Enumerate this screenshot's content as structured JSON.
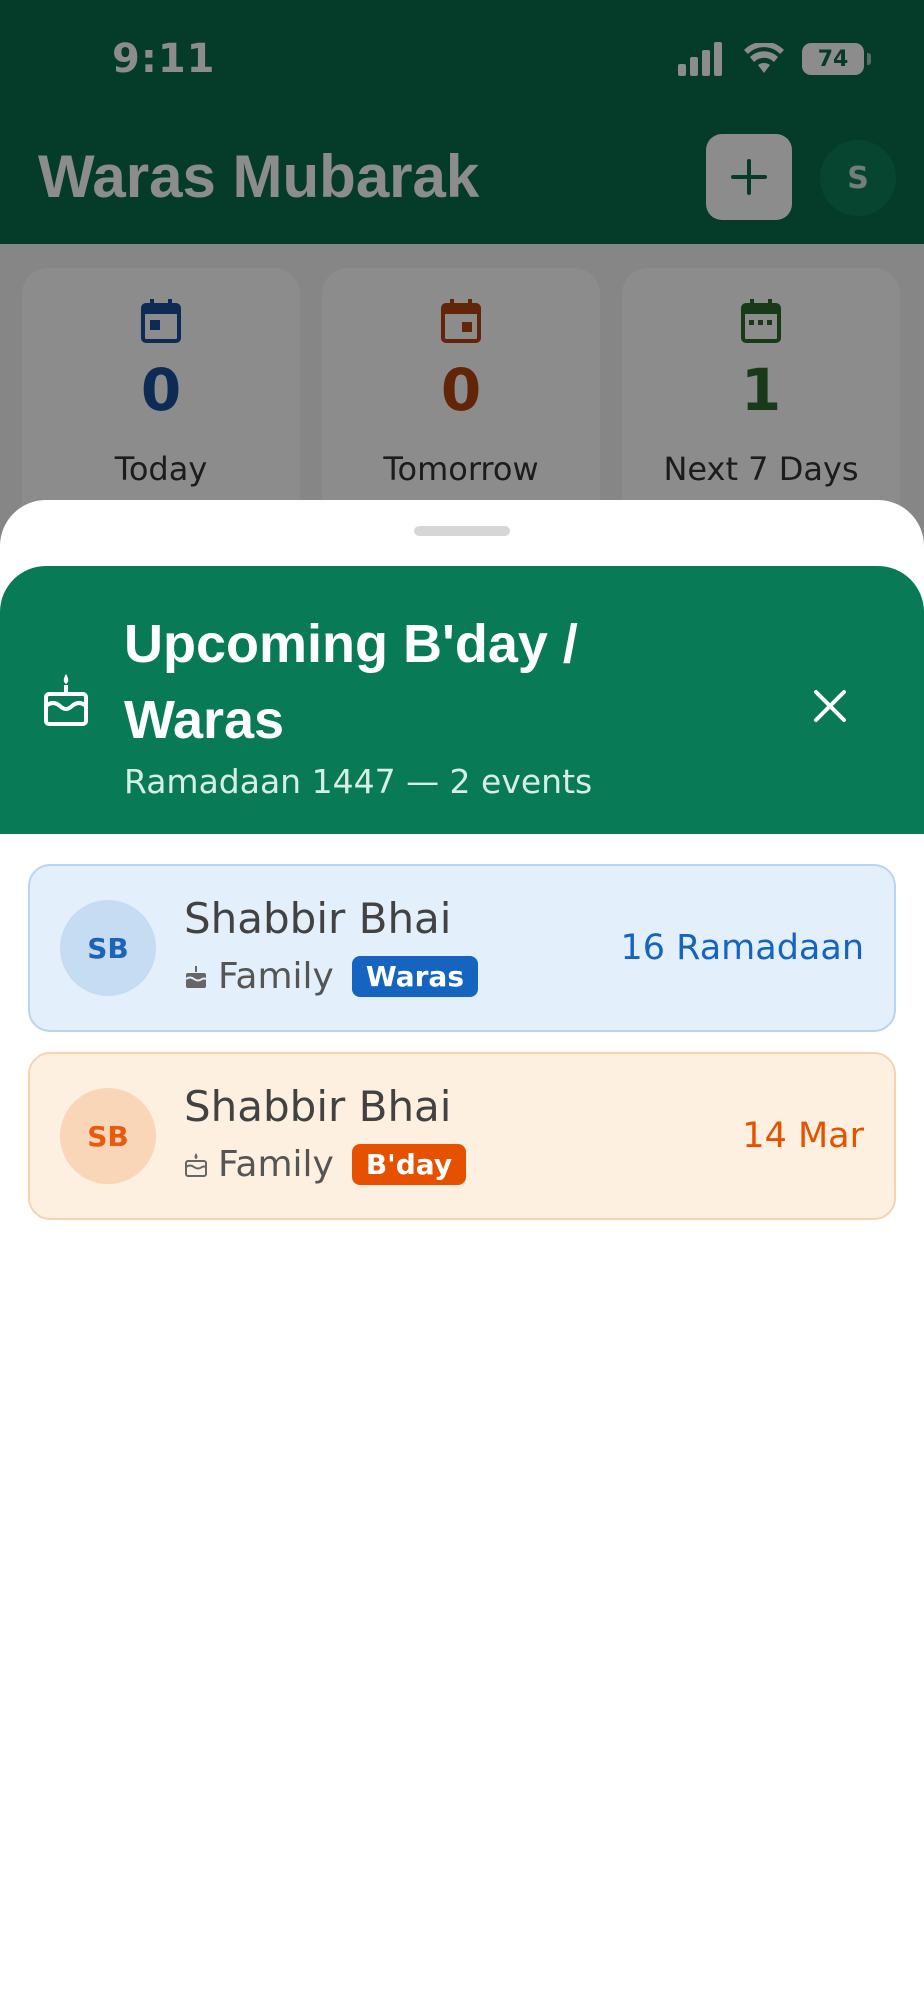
{
  "status_bar": {
    "time": "9:11",
    "battery": "74"
  },
  "header": {
    "title": "Waras Mubarak",
    "add_icon": "plus-icon",
    "avatar_initial": "S"
  },
  "stats": [
    {
      "value": "0",
      "label": "Today",
      "color": "#1a4f9c",
      "icon": "calendar-icon"
    },
    {
      "value": "0",
      "label": "Tomorrow",
      "color": "#b3440e",
      "icon": "calendar-icon"
    },
    {
      "value": "1",
      "label": "Next 7 Days",
      "color": "#2e6b2e",
      "icon": "calendar-icon"
    }
  ],
  "sheet": {
    "title": "Upcoming B'day / Waras",
    "subtitle": "Ramadaan 1447 — 2 events",
    "header_icon": "cake-icon",
    "close_icon": "close-icon",
    "header_color": "#087a56"
  },
  "events": [
    {
      "initials": "SB",
      "name": "Shabbir Bhai",
      "group": "Family",
      "tag": "Waras",
      "date": "16 Ramadaan",
      "accent": "#1565c0"
    },
    {
      "initials": "SB",
      "name": "Shabbir Bhai",
      "group": "Family",
      "tag": "B'day",
      "date": "14 Mar",
      "accent": "#e65100"
    }
  ]
}
